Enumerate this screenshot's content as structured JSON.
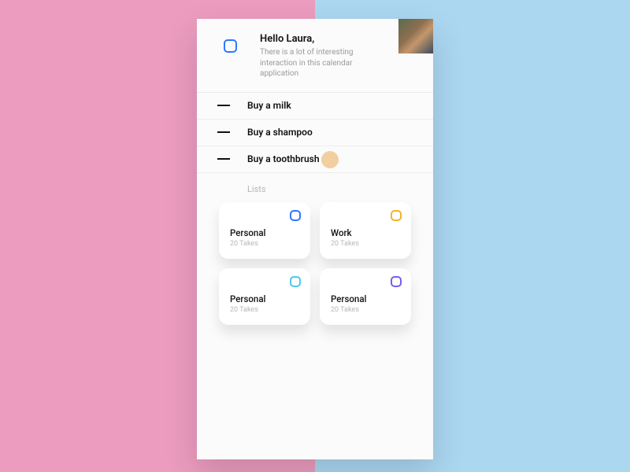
{
  "header": {
    "greeting": "Hello Laura,",
    "subtitle": "There is a lot of interesting interaction in this calendar application",
    "icon_color": "#2e78ff"
  },
  "todos": [
    {
      "label": "Buy a milk"
    },
    {
      "label": "Buy a shampoo"
    },
    {
      "label": "Buy a toothbrush"
    }
  ],
  "lists": {
    "title": "Lists",
    "cards": [
      {
        "name": "Personal",
        "sub": "20 Takes",
        "color": "#2e78ff"
      },
      {
        "name": "Work",
        "sub": "20 Takes",
        "color": "#f0b429"
      },
      {
        "name": "Personal",
        "sub": "20 Takes",
        "color": "#4ec9e6"
      },
      {
        "name": "Personal",
        "sub": "20 Takes",
        "color": "#7a5cf0"
      }
    ]
  }
}
